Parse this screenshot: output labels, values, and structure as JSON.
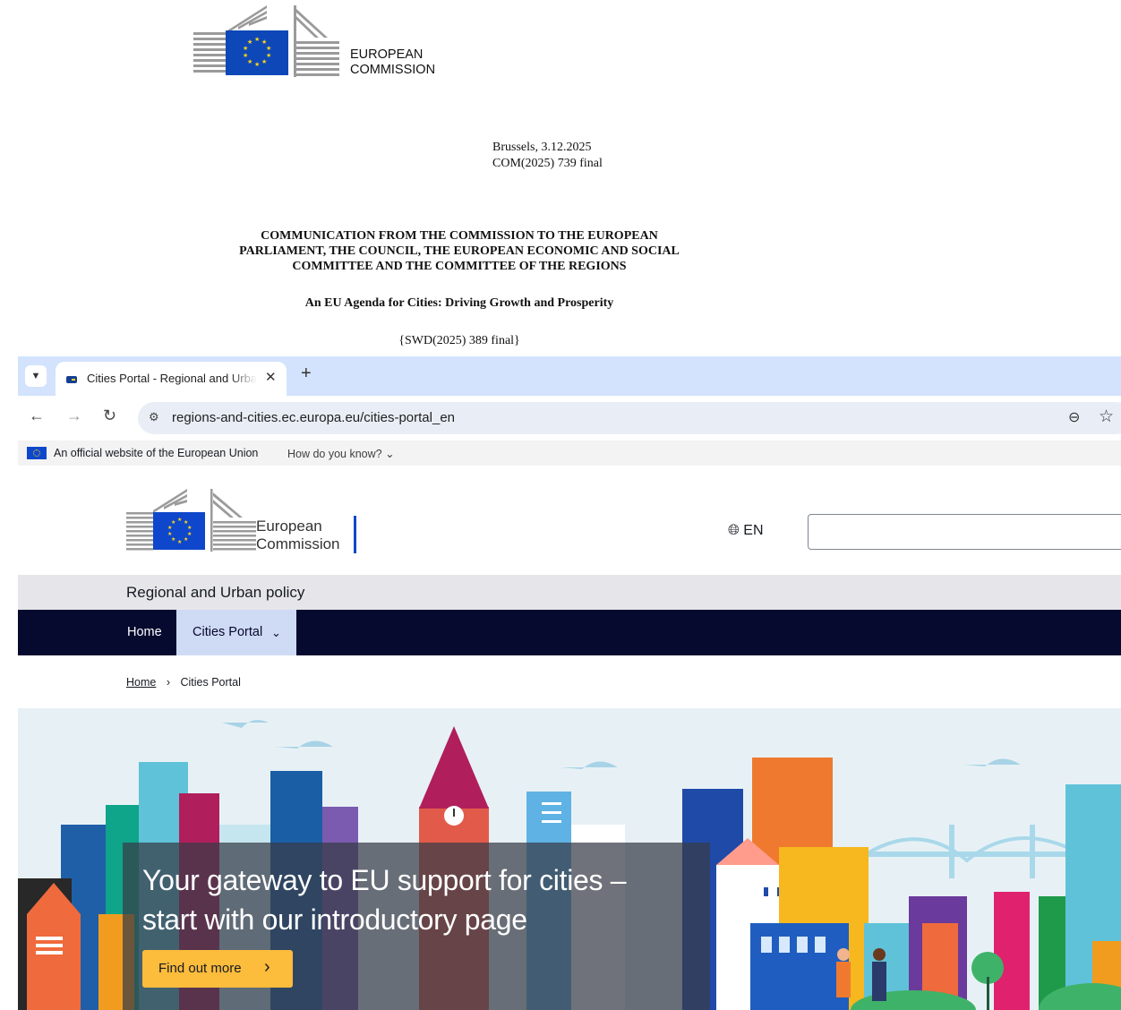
{
  "document": {
    "logo_text_line1": "EUROPEAN",
    "logo_text_line2": "COMMISSION",
    "place_date": "Brussels, 3.12.2025",
    "reference": "COM(2025) 739 final",
    "title_line1": "COMMUNICATION FROM THE COMMISSION TO THE EUROPEAN",
    "title_line2": "PARLIAMENT, THE COUNCIL, THE EUROPEAN ECONOMIC AND SOCIAL",
    "title_line3": "COMMITTEE AND THE COMMITTEE OF THE REGIONS",
    "subtitle": "An EU Agenda for Cities: Driving Growth and Prosperity",
    "swd_reference": "{SWD(2025) 389 final}"
  },
  "browser": {
    "tab_title": "Cities Portal - Regional and Urban policy",
    "tab_close": "✕",
    "new_tab": "+",
    "tab_menu_icon": "chevron-down-icon",
    "url": "regions-and-cities.ec.europa.eu/cities-portal_en"
  },
  "site": {
    "official_banner": "An official website of the European Union",
    "how_know": "How do you know?",
    "logo_line1": "European",
    "logo_line2": "Commission",
    "language": "EN",
    "site_name": "Regional and Urban policy",
    "nav": {
      "home": "Home",
      "cities_portal": "Cities Portal"
    },
    "breadcrumb": {
      "home": "Home",
      "current": "Cities Portal"
    },
    "hero": {
      "title_line1": "Your gateway to EU support for cities –",
      "title_line2": "start with our introductory page",
      "button_label": "Find out more"
    }
  },
  "colors": {
    "nav_background": "#050a2e",
    "nav_active": "#cfdaf5",
    "cta_button": "#fcbc3c",
    "eu_blue": "#0e47cb",
    "tabstrip": "#d3e3fd"
  }
}
